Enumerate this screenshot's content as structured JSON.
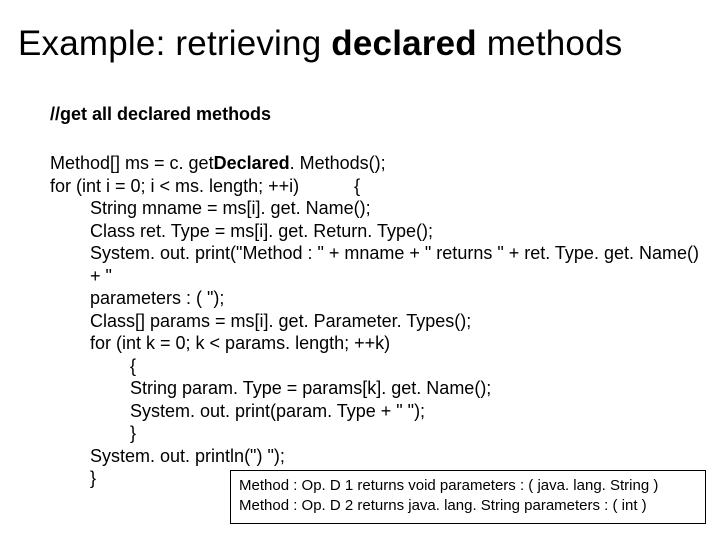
{
  "title": {
    "pre": "Example: retrieving ",
    "bold": "declared",
    "post": " methods"
  },
  "comment": "//get all declared methods",
  "code": {
    "l1a": "Method[] ms = c. get",
    "l1b": "Declared",
    "l1c": ". Methods();",
    "l2": "for (int i = 0; i < ms. length; ++i)           {",
    "l3": "String mname = ms[i]. get. Name();",
    "l4": "Class ret. Type = ms[i]. get. Return. Type();",
    "l5": "System. out. print(\"Method : \" + mname + \" returns \" + ret. Type. get. Name() + \"",
    "l5b": "parameters : ( \");",
    "l6": "Class[] params = ms[i]. get. Parameter. Types();",
    "l7": "for (int k = 0; k < params. length; ++k)",
    "l8": "{",
    "l9": "String param. Type = params[k]. get. Name();",
    "l10": "System. out. print(param. Type + \" \");",
    "l11": "}",
    "l12": "System. out. println(\") \");",
    "l13": "}"
  },
  "output": {
    "line1": "Method : Op. D 1 returns void parameters : ( java. lang. String )",
    "line2": "Method : Op. D 2 returns java. lang. String parameters : ( int )"
  }
}
